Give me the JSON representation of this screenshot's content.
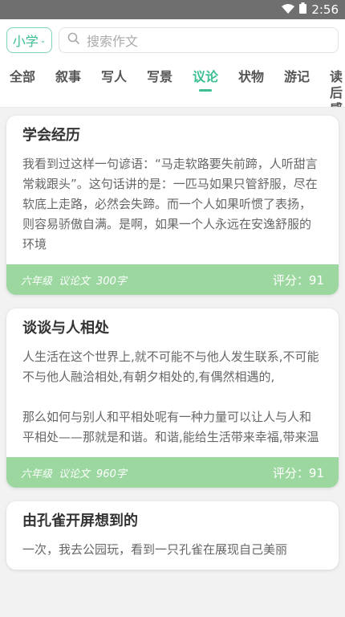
{
  "status": {
    "time": "2:56"
  },
  "header": {
    "grade": "小学",
    "search_placeholder": "搜索作文"
  },
  "tabs": [
    {
      "label": "全部"
    },
    {
      "label": "叙事"
    },
    {
      "label": "写人"
    },
    {
      "label": "写景"
    },
    {
      "label": "议论",
      "active": true
    },
    {
      "label": "状物"
    },
    {
      "label": "游记"
    },
    {
      "label": "读后感"
    }
  ],
  "essays": [
    {
      "title": "学会经历",
      "excerpt": "我看到过这样一句谚语：“马走软路要失前蹄，人听甜言常栽跟头”。这句话讲的是：一匹马如果只管舒服，尽在软底上走路，必然会失蹄。而一个人如果听惯了表扬，则容易骄傲自满。是啊，如果一个人永远在安逸舒服的环境",
      "grade": "六年级",
      "type": "议论文",
      "words": "300字",
      "score": "评分：91"
    },
    {
      "title": "谈谈与人相处",
      "excerpt": "人生活在这个世界上,就不可能不与他人发生联系,不可能不与他人融洽相处,有朝夕相处的,有偶然相遇的,\n\n那么如何与别人和平相处呢有一种力量可以让人与人和平相处——那就是和谐。和谐,能给生活带来幸福,带来温",
      "grade": "六年级",
      "type": "议论文",
      "words": "960字",
      "score": "评分：91"
    },
    {
      "title": "由孔雀开屏想到的",
      "excerpt": "一次，我去公园玩，看到一只孔雀在展现自己美丽",
      "grade": "",
      "type": "",
      "words": "",
      "score": ""
    }
  ]
}
